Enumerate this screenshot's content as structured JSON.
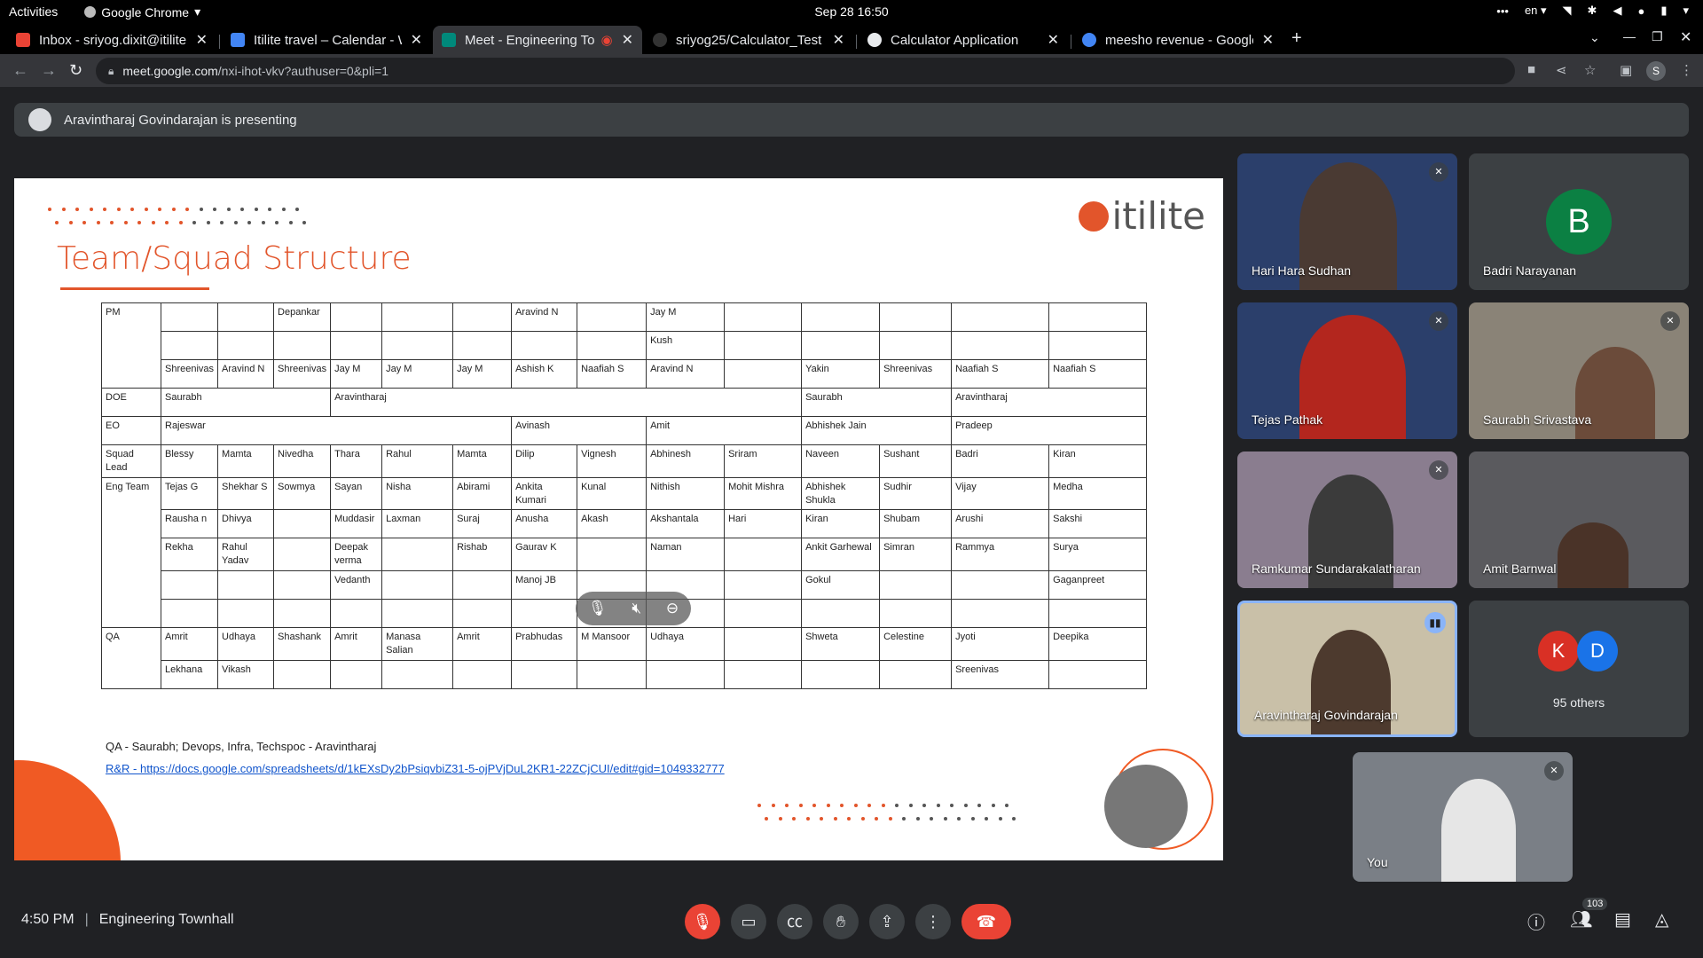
{
  "topbar": {
    "activities": "Activities",
    "app_name": "Google Chrome",
    "clock": "Sep 28  16:50",
    "language": "en"
  },
  "tabs": [
    {
      "title": "Inbox - sriyog.dixit@itilite",
      "favicon_color": "#ea4335"
    },
    {
      "title": "Itilite travel – Calendar - W",
      "favicon_color": "#4285f4"
    },
    {
      "title": "Meet - Engineering To",
      "favicon_color": "#00897b"
    },
    {
      "title": "sriyog25/Calculator_Test",
      "favicon_color": "#9aa0a6"
    },
    {
      "title": "Calculator Application",
      "favicon_color": "#e8eaed"
    },
    {
      "title": "meesho revenue - Google",
      "favicon_color": "#4285f4"
    }
  ],
  "address": {
    "host": "meet.google.com",
    "path": "/nxi-ihot-vkv?authuser=0&pli=1",
    "profile_initial": "S"
  },
  "presenting": {
    "text": "Aravintharaj Govindarajan is presenting"
  },
  "slide": {
    "title": "Team/Squad Structure",
    "logo_text": "itilite",
    "footnote": "QA - Saurabh; Devops, Infra, Techspoc - Aravintharaj",
    "link": "R&R - https://docs.google.com/spreadsheets/d/1kEXsDy2bPsiqvbiZ31-5-ojPVjDuL2KR1-22ZCjCUI/edit#gid=1049332777",
    "table": {
      "row_labels": {
        "pm": "PM",
        "doe": "DOE",
        "eo": "EO",
        "squad_lead": "Squad Lead",
        "eng_team": "Eng Team",
        "qa": "QA"
      },
      "pm_rows": [
        [
          "",
          "",
          "Depankar",
          "",
          "",
          "",
          "Aravind N",
          "",
          "Jay M",
          "",
          "",
          "",
          "",
          ""
        ],
        [
          "",
          "",
          "",
          "",
          "",
          "",
          "",
          "",
          "Kush",
          "",
          "",
          "",
          "",
          ""
        ],
        [
          "Shreenivas",
          "Aravind N",
          "Shreenivas",
          "Jay M",
          "Jay M",
          "Jay M",
          "Ashish K",
          "Naafiah S",
          "Aravind N",
          "",
          "Yakin",
          "Shreenivas",
          "Naafiah S",
          "Naafiah S"
        ]
      ],
      "doe": [
        "Saurabh",
        "Aravintharaj",
        "Saurabh",
        "Aravintharaj"
      ],
      "eo": [
        "Rajeswar",
        "Avinash",
        "Amit",
        "Abhishek Jain",
        "Pradeep"
      ],
      "squad_lead": [
        "Blessy",
        "Mamta",
        "Nivedha",
        "Thara",
        "Rahul",
        "Mamta",
        "Dilip",
        "Vignesh",
        "Abhinesh",
        "Sriram",
        "Naveen",
        "Sushant",
        "Badri",
        "Kiran"
      ],
      "eng_rows": [
        [
          "Tejas G",
          "Shekhar S",
          "Sowmya",
          "Sayan",
          "Nisha",
          "Abirami",
          "Ankita Kumari",
          "Kunal",
          "Nithish",
          "Mohit Mishra",
          "Abhishek Shukla",
          "Sudhir",
          "Vijay",
          "Medha"
        ],
        [
          "Rausha n",
          "Dhivya",
          "",
          "Muddasir",
          "Laxman",
          "Suraj",
          "Anusha",
          "Akash",
          "Akshantala",
          "Hari",
          "Kiran",
          "Shubam",
          "Arushi",
          "Sakshi"
        ],
        [
          "Rekha",
          "Rahul Yadav",
          "",
          "Deepak verma",
          "",
          "Rishab",
          "Gaurav K",
          "",
          "Naman",
          "",
          "Ankit Garhewal",
          "Simran",
          "Rammya",
          "Surya"
        ],
        [
          "",
          "",
          "",
          "Vedanth",
          "",
          "",
          "Manoj JB",
          "",
          "",
          "",
          "Gokul",
          "",
          "",
          "Gaganpreet"
        ],
        [
          "",
          "",
          "",
          "",
          "",
          "",
          "",
          "",
          "",
          "",
          "",
          "",
          "",
          ""
        ]
      ],
      "qa_rows": [
        [
          "Amrit",
          "Udhaya",
          "Shashank",
          "Amrit",
          "Manasa Salian",
          "Amrit",
          "Prabhudas",
          "M Mansoor",
          "Udhaya",
          "",
          "Shweta",
          "Celestine",
          "Jyoti",
          "Deepika"
        ],
        [
          "Lekhana",
          "Vikash",
          "",
          "",
          "",
          "",
          "",
          "",
          "",
          "",
          "",
          "",
          "Sreenivas",
          ""
        ]
      ]
    }
  },
  "participants": [
    {
      "name": "Hari Hara Sudhan",
      "muted": true
    },
    {
      "name": "Badri Narayanan",
      "initial": "B",
      "avatar_color": "#0b8043"
    },
    {
      "name": "Tejas Pathak",
      "muted": true
    },
    {
      "name": "Saurabh Srivastava",
      "muted": true
    },
    {
      "name": "Ramkumar Sundarakalatharan",
      "muted": true
    },
    {
      "name": "Amit Barnwal"
    },
    {
      "name": "Aravintharaj Govindarajan",
      "speaking": true
    },
    {
      "name": "You",
      "muted": true
    }
  ],
  "others": {
    "label": "95 others",
    "initials": [
      "K",
      "D"
    ],
    "colors": [
      "#d93025",
      "#1a73e8"
    ]
  },
  "bottom": {
    "time": "4:50 PM",
    "meeting_name": "Engineering Townhall",
    "people_count": "103"
  }
}
